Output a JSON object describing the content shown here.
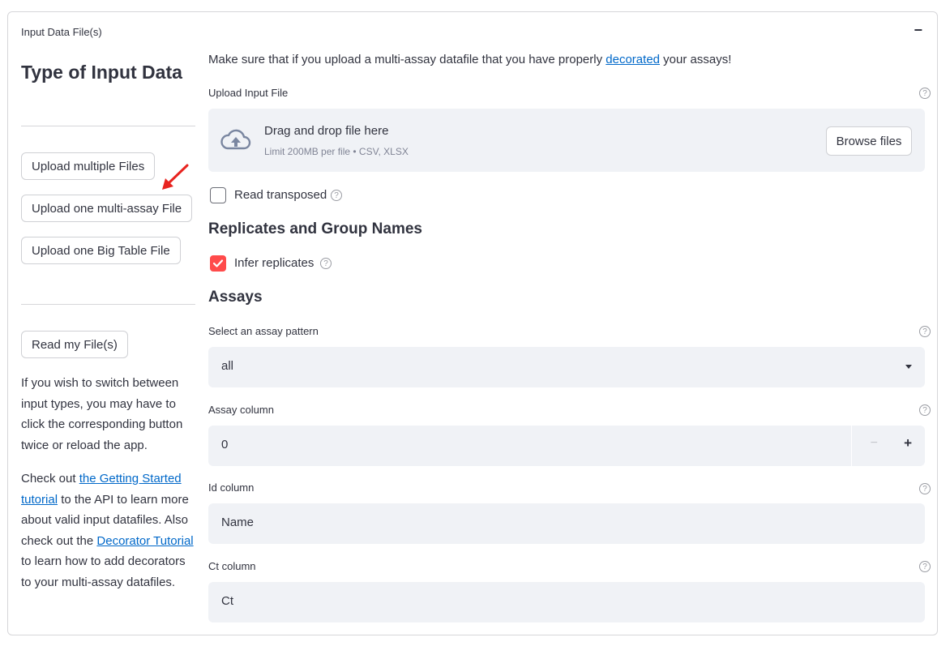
{
  "expander": {
    "title": "Input Data File(s)",
    "collapse_symbol": "−"
  },
  "sidebar": {
    "title": "Type of Input Data",
    "buttons": {
      "multiple": "Upload multiple Files",
      "multi_assay": "Upload one multi-assay File",
      "big_table": "Upload one Big Table File",
      "read": "Read my File(s)"
    },
    "switch_note": "If you wish to switch between input types, you may have to click the corresponding button twice or reload the app.",
    "help_note": {
      "t1": "Check out ",
      "link1": "the Getting Started tutorial",
      "t2": " to the API to learn more about valid input datafiles. Also check out the ",
      "link2": "Decorator Tutorial",
      "t3": " to learn how to add decorators to your multi-assay datafiles."
    }
  },
  "main": {
    "note_pre": "Make sure that if you upload a multi-assay datafile that you have properly ",
    "note_link": "decorated",
    "note_post": " your assays!",
    "upload": {
      "label": "Upload Input File",
      "drag_text": "Drag and drop file here",
      "limit_text": "Limit 200MB per file • CSV, XLSX",
      "browse_label": "Browse files"
    },
    "read_transposed": {
      "label": "Read transposed",
      "checked": false
    },
    "replicates_heading": "Replicates and Group Names",
    "infer_replicates": {
      "label": "Infer replicates",
      "checked": true
    },
    "assays_heading": "Assays",
    "assay_pattern": {
      "label": "Select an assay pattern",
      "value": "all"
    },
    "assay_column": {
      "label": "Assay column",
      "value": "0",
      "minus": "−",
      "plus": "+"
    },
    "id_column": {
      "label": "Id column",
      "value": "Name"
    },
    "ct_column": {
      "label": "Ct column",
      "value": "Ct"
    },
    "help_glyph": "?"
  },
  "colors": {
    "accent": "#ff4b4b",
    "link": "#0068c9",
    "field_bg": "#f0f2f6",
    "annotation_arrow": "#e8231f"
  }
}
